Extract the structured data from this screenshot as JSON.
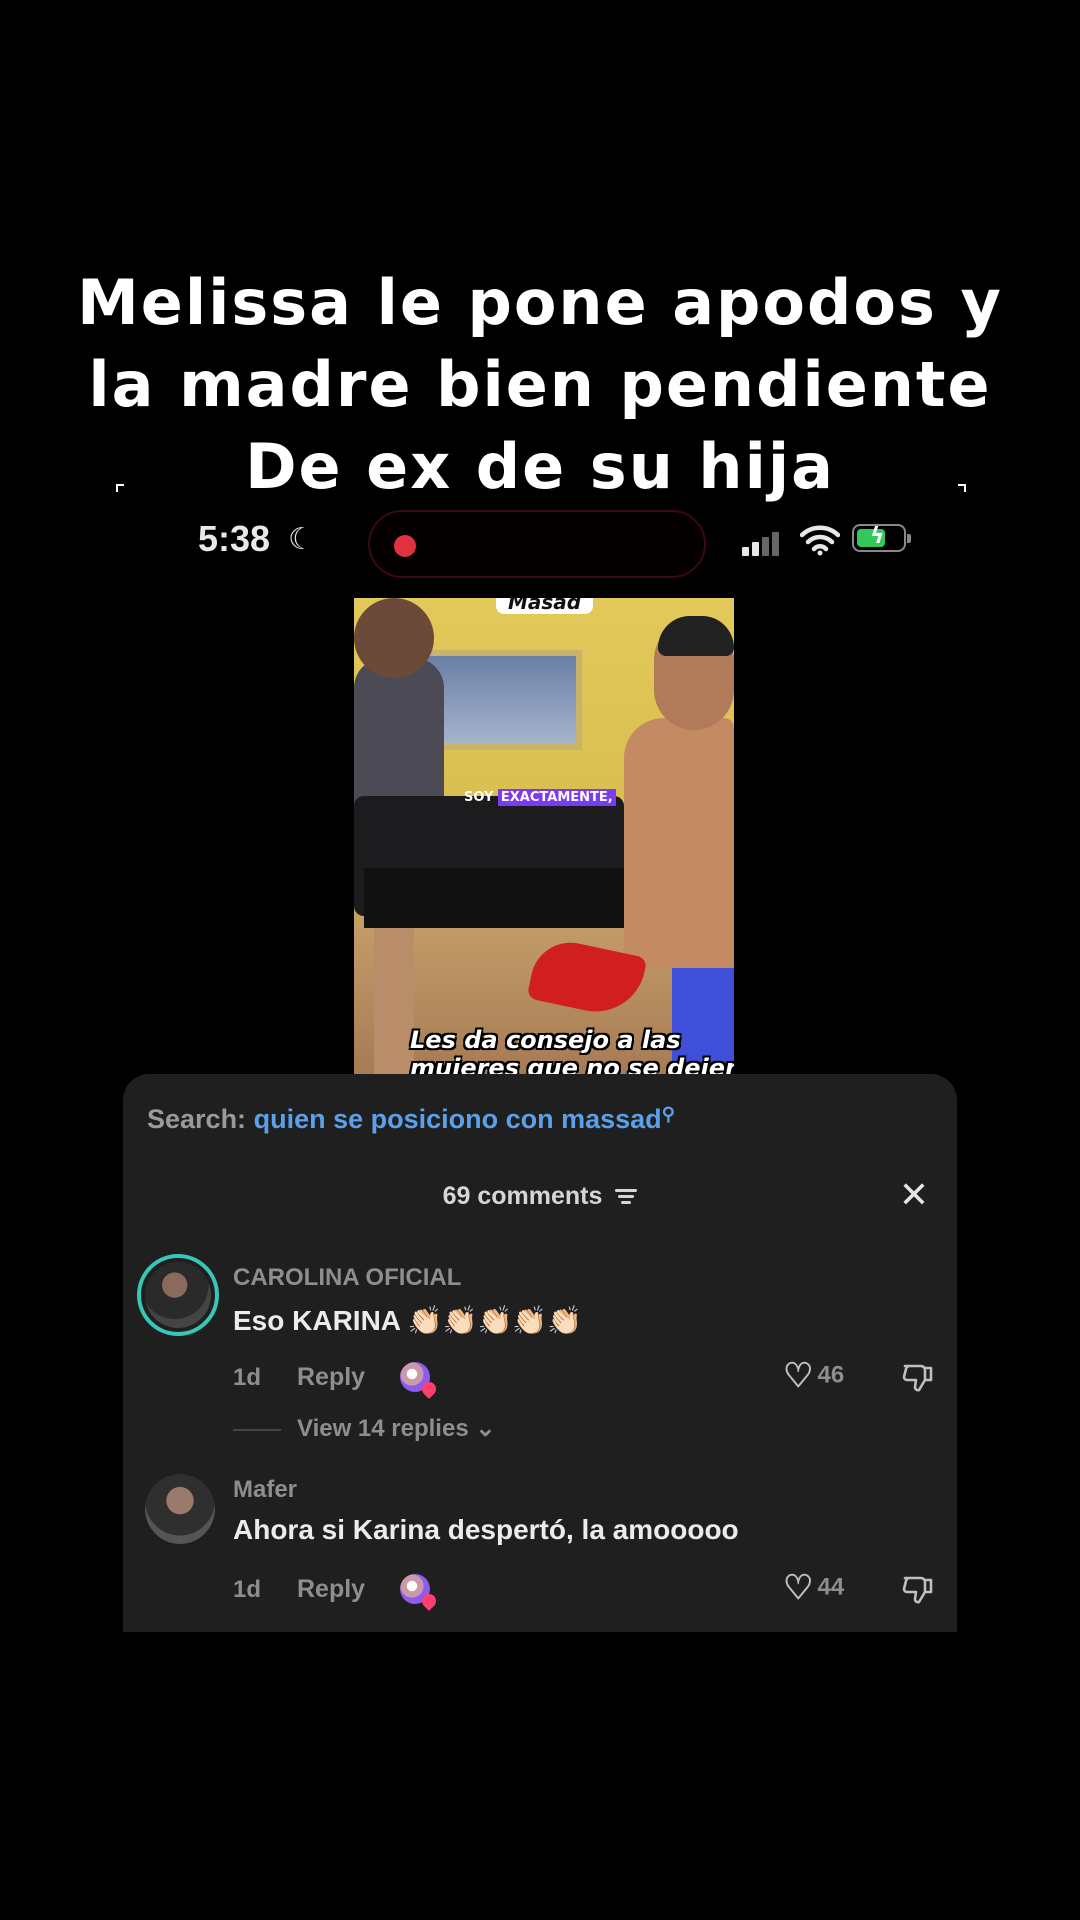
{
  "caption": {
    "line1": "Melissa le pone apodos y",
    "line2": "la madre bien pendiente",
    "line3": "De ex de su hija"
  },
  "status_bar": {
    "time": "5:38",
    "moon_icon": "moon-icon",
    "recording_color": "#e0323e",
    "battery_color": "#34c759"
  },
  "video": {
    "title": "Masad",
    "subtitle_plain": "SOY",
    "subtitle_highlight": "EXACTAMENTE,",
    "caption_line1": "Les da consejo a las",
    "caption_line2": "mujeres que no se dejen"
  },
  "comments_panel": {
    "search_label": "Search:",
    "search_query": "quien se posiciono con massad",
    "count_label": "69 comments",
    "comments": [
      {
        "username": "CAROLINA OFICIAL",
        "text": "Eso KARINA 👏🏻👏🏻👏🏻👏🏻👏🏻",
        "age": "1d",
        "reply_label": "Reply",
        "likes": "46",
        "view_replies": "View 14 replies"
      },
      {
        "username": "Mafer",
        "text": "Ahora si Karina despertó, la amooooo",
        "age": "1d",
        "reply_label": "Reply",
        "likes": "44"
      }
    ]
  }
}
